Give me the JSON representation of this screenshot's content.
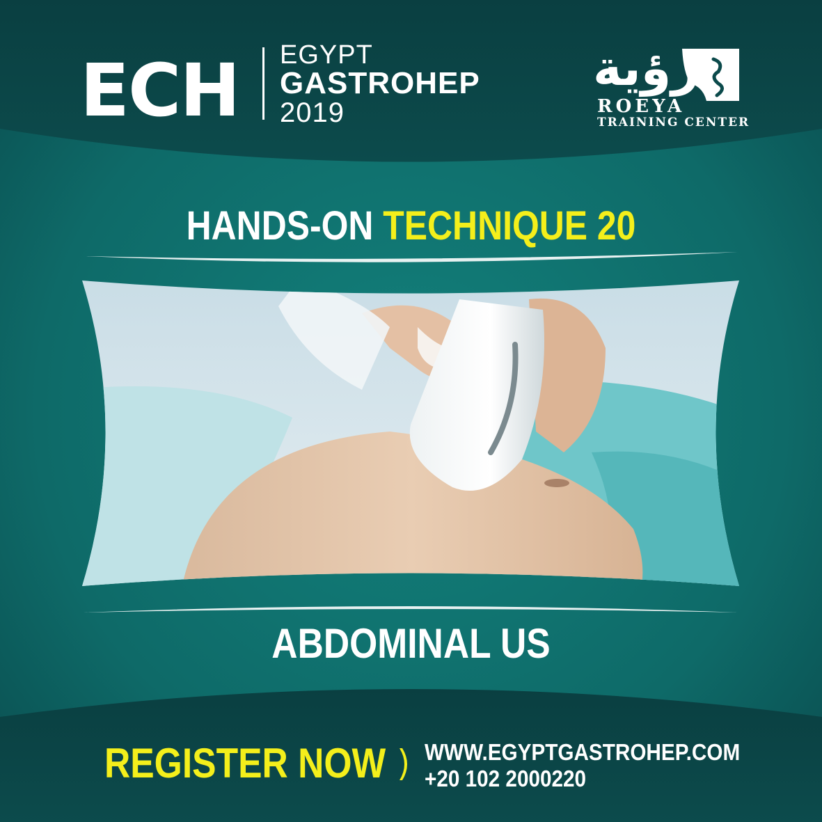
{
  "header": {
    "egh_letters": "ECH",
    "egh_line1": "EGYPT",
    "egh_line2": "GASTROHEP",
    "egh_line3": "2019",
    "roeya_arabic": "رؤية",
    "roeya_name": "ROEYA",
    "roeya_sub": "TRAINING CENTER"
  },
  "headline": {
    "part1": "HANDS-ON",
    "part2": "TECHNIQUE 20"
  },
  "subtitle": "ABDOMINAL US",
  "footer": {
    "cta": "REGISTER NOW",
    "website": "WWW.EGYPTGASTROHEP.COM",
    "phone": "+20 102 2000220"
  },
  "colors": {
    "background": "#0f6666",
    "accent_yellow": "#f4ef1b",
    "text": "#ffffff"
  }
}
